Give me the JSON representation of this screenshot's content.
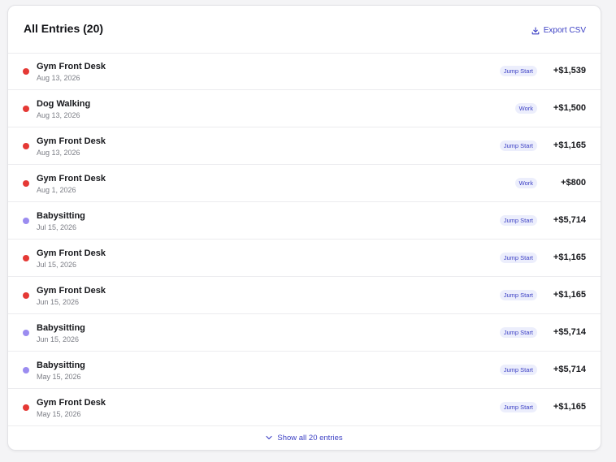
{
  "header": {
    "title": "All Entries (20)",
    "export_label": "Export CSV",
    "export_icon": "download-icon"
  },
  "colors": {
    "red": "#e53935",
    "purple": "#9b8cf0",
    "accent": "#3b3fc4",
    "badge_bg": "#eceefc"
  },
  "entries": [
    {
      "name": "Gym Front Desk",
      "date": "Aug 13, 2026",
      "badge": "Jump Start",
      "amount": "+$1,539",
      "dot": "red"
    },
    {
      "name": "Dog Walking",
      "date": "Aug 13, 2026",
      "badge": "Work",
      "amount": "+$1,500",
      "dot": "red"
    },
    {
      "name": "Gym Front Desk",
      "date": "Aug 13, 2026",
      "badge": "Jump Start",
      "amount": "+$1,165",
      "dot": "red"
    },
    {
      "name": "Gym Front Desk",
      "date": "Aug 1, 2026",
      "badge": "Work",
      "amount": "+$800",
      "dot": "red"
    },
    {
      "name": "Babysitting",
      "date": "Jul 15, 2026",
      "badge": "Jump Start",
      "amount": "+$5,714",
      "dot": "purple"
    },
    {
      "name": "Gym Front Desk",
      "date": "Jul 15, 2026",
      "badge": "Jump Start",
      "amount": "+$1,165",
      "dot": "red"
    },
    {
      "name": "Gym Front Desk",
      "date": "Jun 15, 2026",
      "badge": "Jump Start",
      "amount": "+$1,165",
      "dot": "red"
    },
    {
      "name": "Babysitting",
      "date": "Jun 15, 2026",
      "badge": "Jump Start",
      "amount": "+$5,714",
      "dot": "purple"
    },
    {
      "name": "Babysitting",
      "date": "May 15, 2026",
      "badge": "Jump Start",
      "amount": "+$5,714",
      "dot": "purple"
    },
    {
      "name": "Gym Front Desk",
      "date": "May 15, 2026",
      "badge": "Jump Start",
      "amount": "+$1,165",
      "dot": "red"
    }
  ],
  "footer": {
    "show_all_label": "Show all 20 entries",
    "show_all_icon": "chevron-down-icon"
  }
}
